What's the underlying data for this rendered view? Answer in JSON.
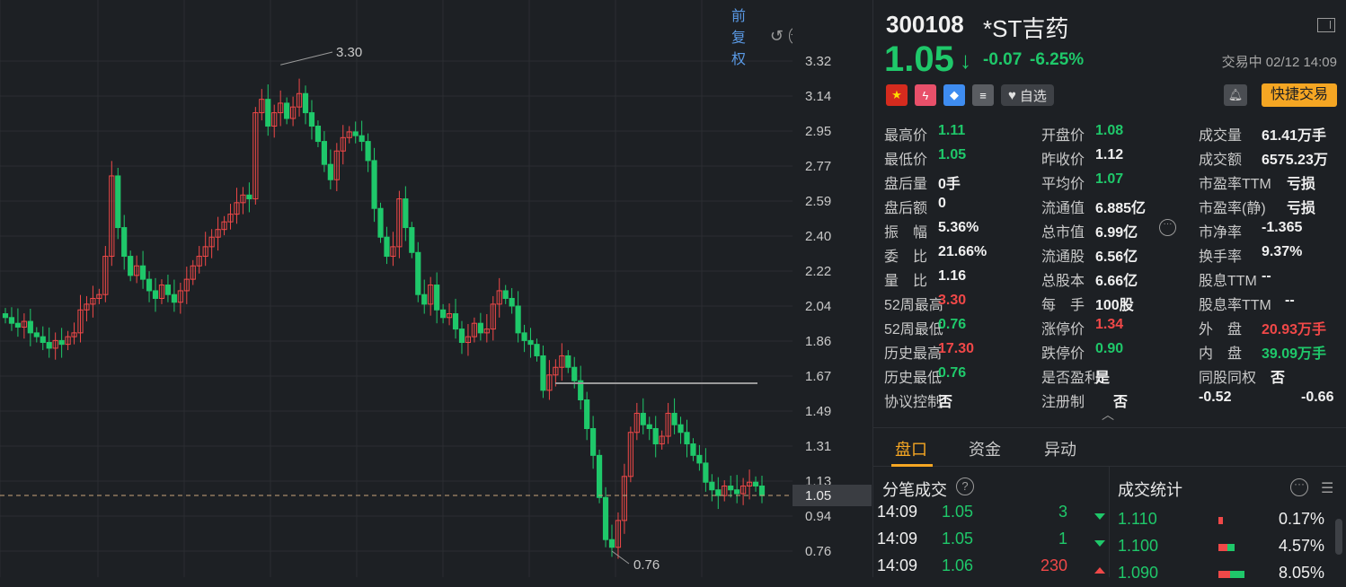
{
  "chart": {
    "adjust_label": "前复权",
    "high_marker": "3.30",
    "low_marker": "0.76",
    "y_ticks": [
      "3.32",
      "3.14",
      "2.95",
      "2.77",
      "2.59",
      "2.40",
      "2.22",
      "2.04",
      "1.86",
      "1.67",
      "1.49",
      "1.31",
      "1.13",
      "0.94",
      "0.76"
    ],
    "current_price_tag": "1.05"
  },
  "stock": {
    "code": "300108",
    "name": "*ST吉药",
    "price": "1.05",
    "change": "-0.07",
    "change_pct": "-6.25%",
    "status": "交易中 02/12 14:09",
    "watch_label": "自选",
    "quick_trade_label": "快捷交易"
  },
  "stats": {
    "rows": [
      {
        "l1": "最高价",
        "v1": "1.11",
        "c1": "green",
        "l2": "开盘价",
        "v2": "1.08",
        "c2": "green",
        "l3": "成交量",
        "v3": "61.41万手",
        "c3": "white"
      },
      {
        "l1": "最低价",
        "v1": "1.05",
        "c1": "green",
        "l2": "昨收价",
        "v2": "1.12",
        "c2": "white",
        "l3": "成交额",
        "v3": "6575.23万",
        "c3": "white"
      },
      {
        "l1": "盘后量",
        "v1": "0手",
        "c1": "white",
        "l2": "平均价",
        "v2": "1.07",
        "c2": "green",
        "l3": "市盈率TTM",
        "v3": "亏损",
        "c3": "white"
      },
      {
        "l1": "盘后额",
        "v1": "0",
        "c1": "white",
        "l2": "流通值",
        "v2": "6.885亿",
        "c2": "white",
        "l3": "市盈率(静)",
        "v3": "亏损",
        "c3": "white"
      },
      {
        "l1": "振　幅",
        "v1": "5.36%",
        "c1": "white",
        "l2": "总市值",
        "v2": "6.99亿",
        "c2": "white",
        "l3": "市净率",
        "v3": "-1.365",
        "c3": "white"
      },
      {
        "l1": "委　比",
        "v1": "21.66%",
        "c1": "white",
        "l2": "流通股",
        "v2": "6.56亿",
        "c2": "white",
        "l3": "换手率",
        "v3": "9.37%",
        "c3": "white"
      },
      {
        "l1": "量　比",
        "v1": "1.16",
        "c1": "white",
        "l2": "总股本",
        "v2": "6.66亿",
        "c2": "white",
        "l3": "股息TTM",
        "v3": "--",
        "c3": "white"
      },
      {
        "l1": "52周最高",
        "v1": "3.30",
        "c1": "red",
        "l2": "每　手",
        "v2": "100股",
        "c2": "white",
        "l3": "股息率TTM",
        "v3": "--",
        "c3": "white"
      },
      {
        "l1": "52周最低",
        "v1": "0.76",
        "c1": "green",
        "l2": "涨停价",
        "v2": "1.34",
        "c2": "red",
        "l3": "外　盘",
        "v3": "20.93万手",
        "c3": "red"
      },
      {
        "l1": "历史最高",
        "v1": "17.30",
        "c1": "red",
        "l2": "跌停价",
        "v2": "0.90",
        "c2": "green",
        "l3": "内　盘",
        "v3": "39.09万手",
        "c3": "green"
      },
      {
        "l1": "历史最低",
        "v1": "0.76",
        "c1": "green",
        "l2": "是否盈利",
        "v2": "是",
        "c2": "white",
        "l3": "同股同权",
        "v3": "否",
        "c3": "white"
      },
      {
        "l1": "协议控制",
        "v1": "否",
        "c1": "white",
        "l2": "注册制",
        "v2": "否",
        "c2": "white",
        "l3": "-0.52",
        "v3": "-0.66",
        "c3": "white"
      }
    ]
  },
  "tabs": [
    "盘口",
    "资金",
    "异动"
  ],
  "ticks_section": {
    "title": "分笔成交",
    "rows": [
      {
        "time": "14:09",
        "price": "1.05",
        "vol": "3",
        "dir": "down"
      },
      {
        "time": "14:09",
        "price": "1.05",
        "vol": "1",
        "dir": "down"
      },
      {
        "time": "14:09",
        "price": "1.06",
        "vol": "230",
        "dir": "up"
      }
    ]
  },
  "dist_section": {
    "title": "成交统计",
    "rows": [
      {
        "price": "1.110",
        "pct": "0.17%",
        "red": 0.3,
        "green": 0
      },
      {
        "price": "1.100",
        "pct": "4.57%",
        "red": 0.6,
        "green": 0.5
      },
      {
        "price": "1.090",
        "pct": "8.05%",
        "red": 0.8,
        "green": 1.0
      }
    ]
  },
  "colors": {
    "up": "#f04848",
    "down": "#1fc86a",
    "accent": "#f5a623",
    "link": "#5a9ae6"
  }
}
